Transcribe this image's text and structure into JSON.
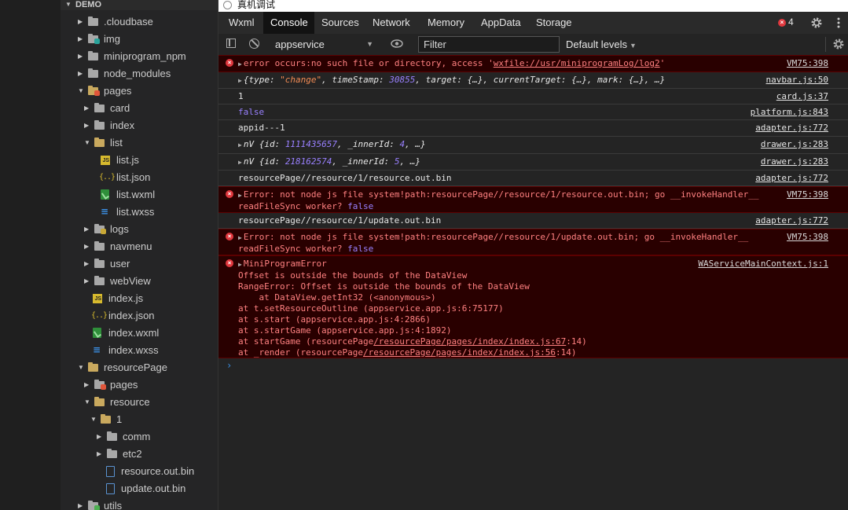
{
  "explorer": {
    "title": "DEMO",
    "items": [
      {
        "label": ".cloudbase"
      },
      {
        "label": "img"
      },
      {
        "label": "miniprogram_npm"
      },
      {
        "label": "node_modules"
      },
      {
        "label": "pages"
      },
      {
        "label": "card"
      },
      {
        "label": "index"
      },
      {
        "label": "list"
      },
      {
        "label": "list.js"
      },
      {
        "label": "list.json"
      },
      {
        "label": "list.wxml"
      },
      {
        "label": "list.wxss"
      },
      {
        "label": "logs"
      },
      {
        "label": "navmenu"
      },
      {
        "label": "user"
      },
      {
        "label": "webView"
      },
      {
        "label": "index.js"
      },
      {
        "label": "index.json"
      },
      {
        "label": "index.wxml"
      },
      {
        "label": "index.wxss"
      },
      {
        "label": "resourcePage"
      },
      {
        "label": "pages"
      },
      {
        "label": "resource"
      },
      {
        "label": "1"
      },
      {
        "label": "comm"
      },
      {
        "label": "etc2"
      },
      {
        "label": "resource.out.bin"
      },
      {
        "label": "update.out.bin"
      },
      {
        "label": "utils"
      }
    ]
  },
  "window": {
    "title": "真机调试"
  },
  "tabs": [
    "Wxml",
    "Console",
    "Sources",
    "Network",
    "Memory",
    "AppData",
    "Storage"
  ],
  "error_count": "4",
  "toolbar": {
    "context": "appservice",
    "filter_placeholder": "Filter",
    "levels": "Default levels"
  },
  "console": {
    "m1": {
      "pre": "error occurs:no such file or directory, access '",
      "link": "wxfile://usr/miniprogramLog/log2",
      "post": "'",
      "src": "VM75:398"
    },
    "m2": {
      "a": "{type: ",
      "b": "\"change\"",
      "c": ", timeStamp: ",
      "d": "30855",
      "e": ", target: {…}, currentTarget: {…}, mark: {…}, …}",
      "src": "navbar.js:50"
    },
    "m3": {
      "text": "1",
      "src": "card.js:37"
    },
    "m4": {
      "text": "false",
      "src": "platform.js:843"
    },
    "m5": {
      "text": "appid---1",
      "src": "adapter.js:772"
    },
    "m6": {
      "a": "nV {id: ",
      "b": "1111435657",
      "c": ", _innerId: ",
      "d": "4",
      "e": ", …}",
      "src": "drawer.js:283"
    },
    "m7": {
      "a": "nV {id: ",
      "b": "218162574",
      "c": ", _innerId: ",
      "d": "5",
      "e": ", …}",
      "src": "drawer.js:283"
    },
    "m8": {
      "text": "resourcePage//resource/1/resource.out.bin",
      "src": "adapter.js:772"
    },
    "m9": {
      "l1": "Error: not node js file system!path:resourcePage//resource/1/resource.out.bin; go __invokeHandler__",
      "l2a": "readFileSync worker? ",
      "l2b": "false",
      "src": "VM75:398"
    },
    "m10": {
      "text": "resourcePage//resource/1/update.out.bin",
      "src": "adapter.js:772"
    },
    "m11": {
      "l1": "Error: not node js file system!path:resourcePage//resource/1/update.out.bin; go __invokeHandler__",
      "l2a": "readFileSync worker? ",
      "l2b": "false",
      "src": "VM75:398"
    },
    "m12": {
      "head": "MiniProgramError",
      "src": "WAServiceMainContext.js:1",
      "l1": "Offset is outside the bounds of the DataView",
      "l2": "RangeError: Offset is outside the bounds of the DataView",
      "l3": "    at DataView.getInt32 (<anonymous>)",
      "l4": "at t.setResourceOutline (appservice.app.js:6:75177)",
      "l5": "at s.start (appservice.app.js:4:2866)",
      "l6": "at s.startGame (appservice.app.js:4:1892)",
      "l7a": "at startGame (resourcePage",
      "l7b": "/resourcePage/pages/index/index.js:67",
      "l7c": ":14)",
      "l8a": "at _render (resourcePage",
      "l8b": "/resourcePage/pages/index/index.js:56",
      "l8c": ":14)"
    },
    "prompt": "›"
  }
}
